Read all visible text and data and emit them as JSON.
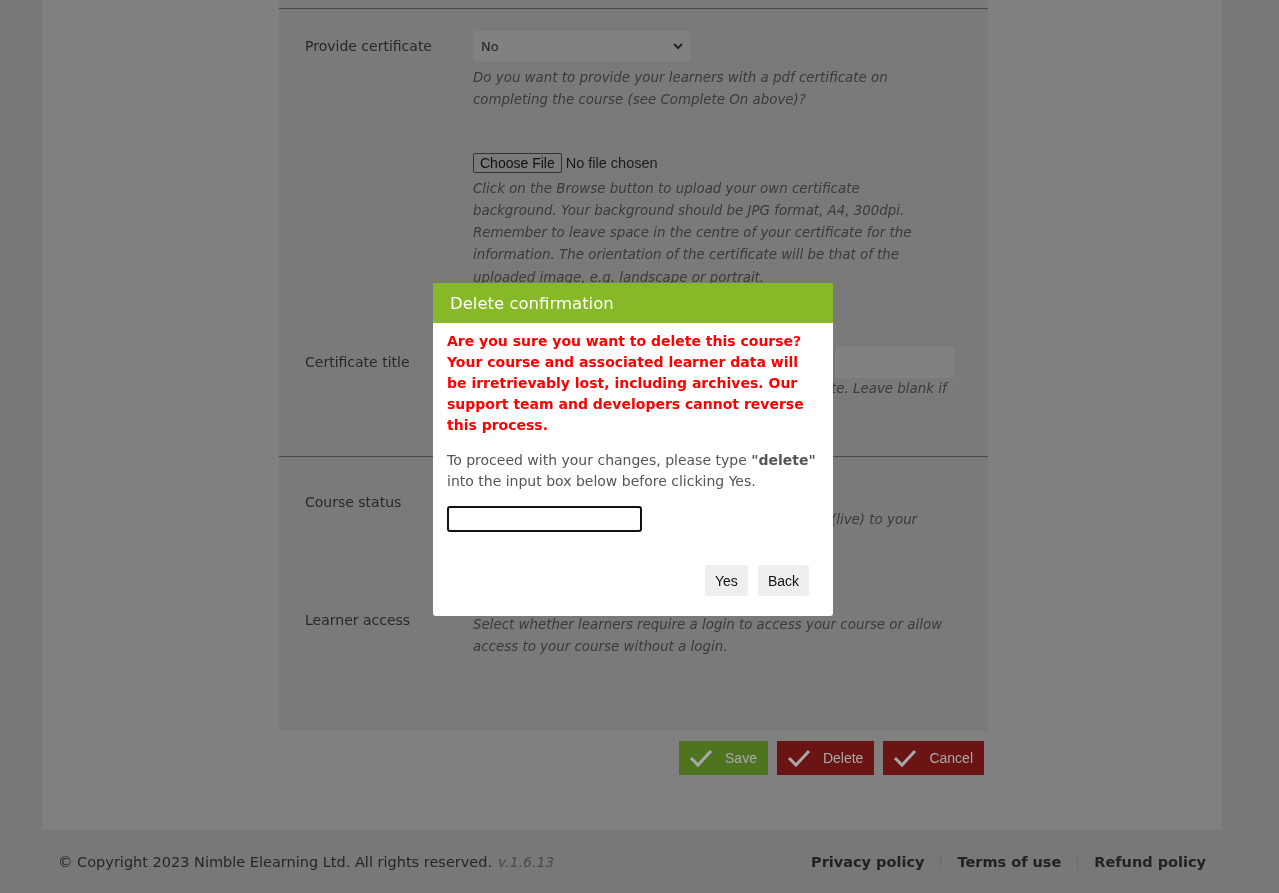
{
  "form": {
    "rows": [
      {
        "kind": "select",
        "label": "Provide certificate",
        "value": "No",
        "hint": "Do you want to provide your learners with a pdf certificate on completing the course (see Complete On above)?"
      },
      {
        "kind": "file",
        "button": "Choose File",
        "status": "No file chosen",
        "hint": "Click on the Browse button to upload your own certificate background. Your background should be JPG format, A4, 300dpi. Remember to leave space in the centre of your certificate for the information. The orientation of the certificate will be that of the uploaded image, e.g. landscape or portrait."
      },
      {
        "kind": "text",
        "label": "Certificate title",
        "hint": "te. Leave blank if"
      },
      {
        "kind": "divider"
      },
      {
        "kind": "status",
        "label": "Course status",
        "hint": "(live) to your"
      },
      {
        "kind": "covered-select",
        "label": "Learner access",
        "hint": "Select whether learners require a login to access your course or allow access to your course without a login."
      }
    ]
  },
  "actions": [
    {
      "kind": "save",
      "label": "Save"
    },
    {
      "kind": "delete",
      "label": "Delete"
    },
    {
      "kind": "cancel",
      "label": "Cancel"
    }
  ],
  "footer": {
    "copyright": "© Copyright 2023 Nimble Elearning Ltd. All rights reserved.",
    "version": "v.1.6.13",
    "links": [
      "Privacy policy",
      "Terms of use",
      "Refund policy"
    ]
  },
  "dialog": {
    "title": "Delete confirmation",
    "warning": "Are you sure you want to delete this course? Your course and associated learner data will be irretrievably lost, including archives. Our support team and developers cannot reverse this process.",
    "instruction": "To proceed with your changes, please type **\"delete\"** into the input box below before clicking Yes.",
    "buttons": [
      "Yes",
      "Back"
    ]
  }
}
